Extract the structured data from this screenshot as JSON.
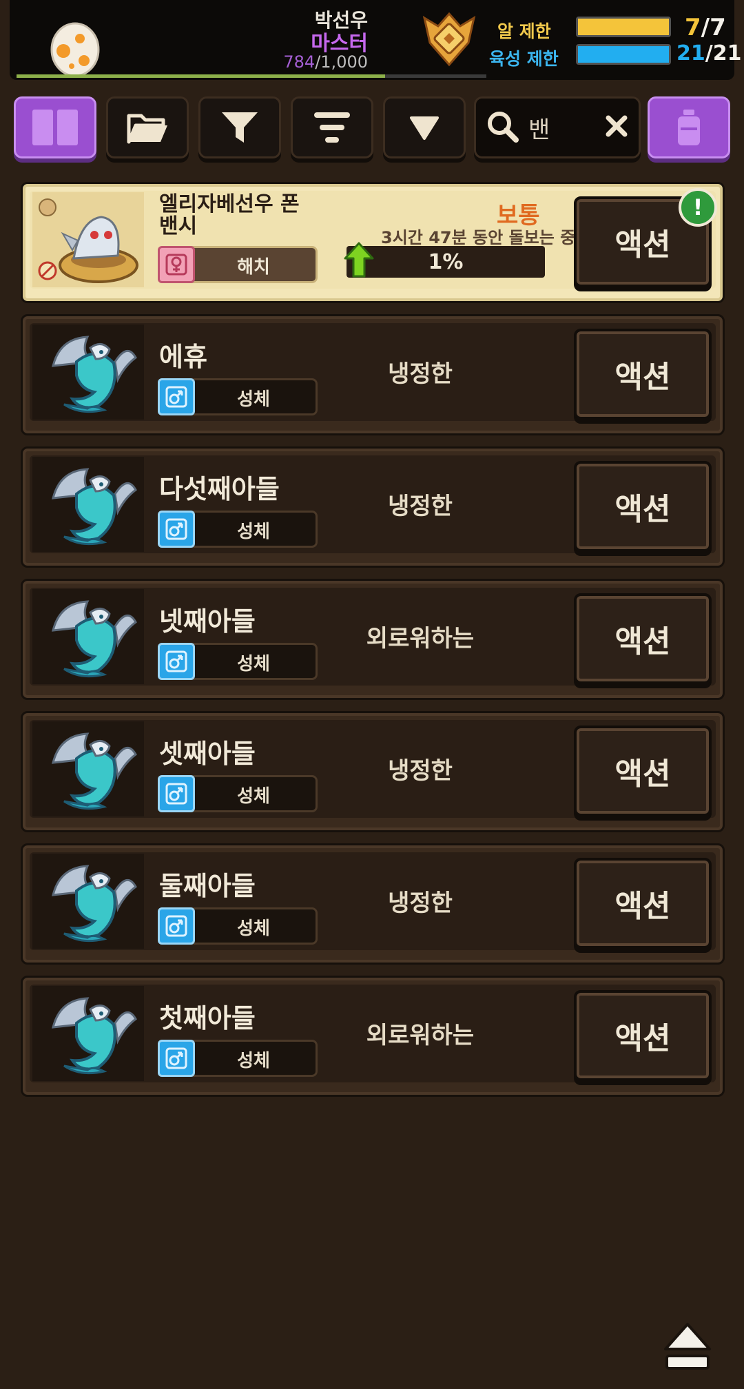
{
  "header": {
    "user_name": "박선우",
    "user_rank": "마스터",
    "xp_current": "784",
    "xp_max": "/1,000",
    "xp_progress": 0.784,
    "egg_limit_label": "알 제한",
    "egg_limit_current": "7",
    "egg_limit_max": "/7",
    "egg_limit_fill": 1.0,
    "grow_limit_label": "육성 제한",
    "grow_limit_current": "21",
    "grow_limit_max": "/21",
    "grow_limit_fill": 1.0,
    "colors": {
      "rank": "#c668ee",
      "egg": "#f4c43a",
      "grow": "#22aef0"
    }
  },
  "toolbar": {
    "icons": [
      "grid-view-icon",
      "folder-icon",
      "filter-icon",
      "sort-icon",
      "dropdown-icon",
      "search-icon",
      "potion-icon"
    ],
    "search_value": "밴",
    "clear_icon": "close-icon"
  },
  "hatching": {
    "name": "엘리자베선우 폰 밴시",
    "gender": "female",
    "stage": "해치",
    "difficulty": "보통",
    "time_text": "3시간 47분 동안 돌보는 중",
    "progress": "1%",
    "action_label": "액션",
    "alert": "!"
  },
  "dragons": [
    {
      "name": "에휴",
      "gender": "male",
      "stage": "성체",
      "mood": "냉정한",
      "action_label": "액션"
    },
    {
      "name": "다섯째아들",
      "gender": "male",
      "stage": "성체",
      "mood": "냉정한",
      "action_label": "액션"
    },
    {
      "name": "넷째아들",
      "gender": "male",
      "stage": "성체",
      "mood": "외로워하는",
      "action_label": "액션"
    },
    {
      "name": "셋째아들",
      "gender": "male",
      "stage": "성체",
      "mood": "냉정한",
      "action_label": "액션"
    },
    {
      "name": "둘째아들",
      "gender": "male",
      "stage": "성체",
      "mood": "냉정한",
      "action_label": "액션"
    },
    {
      "name": "첫째아들",
      "gender": "male",
      "stage": "성체",
      "mood": "외로워하는",
      "action_label": "액션"
    }
  ],
  "scroll_top_icon": "eject-arrow-icon"
}
